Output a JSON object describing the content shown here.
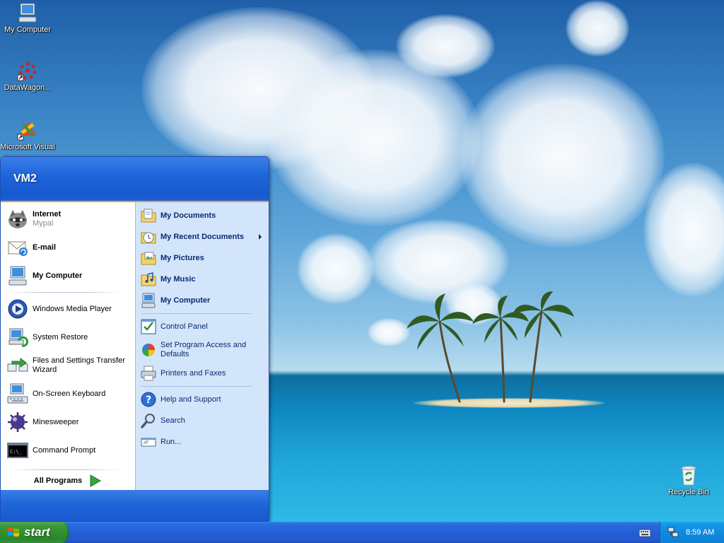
{
  "desktop": {
    "icons": [
      {
        "label": "My Computer"
      },
      {
        "label": "DataWagon..."
      },
      {
        "label": "Microsoft Visual"
      },
      {
        "label": "Recycle Bin"
      }
    ]
  },
  "start_menu": {
    "username": "VM2",
    "pinned": [
      {
        "title": "Internet",
        "subtitle": "Mypal"
      },
      {
        "title": "E-mail"
      },
      {
        "title": "My Computer"
      }
    ],
    "recent": [
      {
        "label": "Windows Media Player"
      },
      {
        "label": "System Restore"
      },
      {
        "label": "Files and Settings Transfer Wizard"
      },
      {
        "label": "On-Screen Keyboard"
      },
      {
        "label": "Minesweeper"
      },
      {
        "label": "Command Prompt"
      }
    ],
    "all_programs": "All Programs",
    "places": [
      {
        "label": "My Documents"
      },
      {
        "label": "My Recent Documents"
      },
      {
        "label": "My Pictures"
      },
      {
        "label": "My Music"
      },
      {
        "label": "My Computer"
      }
    ],
    "settings": [
      {
        "label": "Control Panel"
      },
      {
        "label": "Set Program Access and Defaults"
      },
      {
        "label": "Printers and Faxes"
      }
    ],
    "tools": [
      {
        "label": "Help and Support"
      },
      {
        "label": "Search"
      },
      {
        "label": "Run..."
      }
    ]
  },
  "taskbar": {
    "start_label": "start",
    "clock": "8:59 AM"
  },
  "colors": {
    "start_green": "#2f8f2f",
    "menu_blue": "#1f66d9",
    "right_panel": "#d3e5fa",
    "accent_orange": "#f29a2e"
  }
}
